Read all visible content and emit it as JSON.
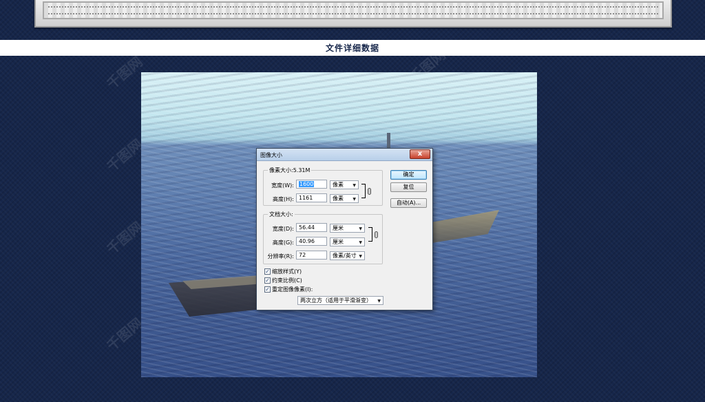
{
  "page": {
    "heading": "文件详细数据",
    "watermark": "千图网"
  },
  "dialog": {
    "title": "图像大小",
    "close": "x",
    "pixel_dimensions": {
      "legend": "像素大小:5.31M",
      "width_label": "宽度(W):",
      "width_value": "1600",
      "width_unit": "像素",
      "height_label": "高度(H):",
      "height_value": "1161",
      "height_unit": "像素"
    },
    "document_size": {
      "legend": "文档大小:",
      "width_label": "宽度(D):",
      "width_value": "56.44",
      "width_unit": "厘米",
      "height_label": "高度(G):",
      "height_value": "40.96",
      "height_unit": "厘米",
      "resolution_label": "分辨率(R):",
      "resolution_value": "72",
      "resolution_unit": "像素/英寸"
    },
    "buttons": {
      "ok": "确定",
      "reset": "复位",
      "auto": "自动(A)..."
    },
    "checkboxes": [
      {
        "label": "缩放样式(Y)",
        "checked": true,
        "mark": "✓"
      },
      {
        "label": "约束比例(C)",
        "checked": true,
        "mark": "✓"
      },
      {
        "label": "重定图像像素(I):",
        "checked": true,
        "mark": "✓"
      }
    ],
    "resample_method": "两次立方（适用于平滑渐变）"
  },
  "icons": {
    "dropdown": "▼"
  }
}
